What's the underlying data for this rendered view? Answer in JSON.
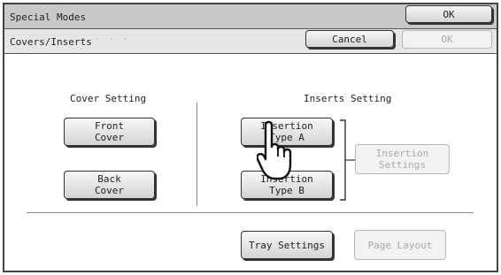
{
  "header": {
    "title": "Special Modes",
    "ok_label": "OK"
  },
  "subheader": {
    "title": "Covers/Inserts",
    "cancel_label": "Cancel",
    "ok_label": "OK"
  },
  "cover_setting": {
    "heading": "Cover Setting",
    "front_label": "Front\nCover",
    "back_label": "Back\nCover"
  },
  "inserts_setting": {
    "heading": "Inserts Setting",
    "type_a_label": "Insertion\nType A",
    "type_b_label": "Insertion\nType B",
    "settings_label": "Insertion\nSettings"
  },
  "footer": {
    "tray_label": "Tray Settings",
    "layout_label": "Page Layout"
  },
  "icons": {
    "pointer": "hand-pointer-icon"
  }
}
